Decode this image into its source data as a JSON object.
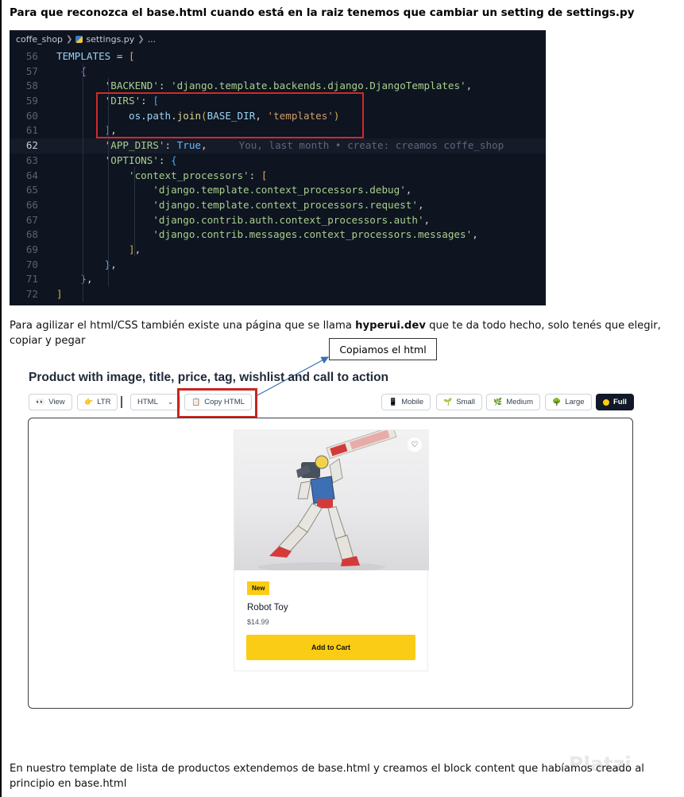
{
  "doc": {
    "heading": "Para que reconozca el base.html cuando está en la raiz tenemos que cambiar un setting de settings.py",
    "para2_before": "Para agilizar el html/CSS también existe una página que se llama ",
    "para2_bold": "hyperui.dev",
    "para2_after": " que te da todo hecho, solo tenés que elegir, copiar y pegar",
    "callout": "Copiamos el html",
    "para3": "En nuestro template de lista de productos extendemos de base.html y creamos el block content que habíamos creado al principio en base.html",
    "watermark": "Platzi"
  },
  "editor": {
    "breadcrumb": [
      "coffe_shop",
      "settings.py",
      "..."
    ],
    "lines": [
      {
        "n": "56",
        "t": "TEMPLATES = ["
      },
      {
        "n": "57",
        "t": "{"
      },
      {
        "n": "58",
        "t": "'BACKEND': 'django.template.backends.django.DjangoTemplates',"
      },
      {
        "n": "59",
        "t": "'DIRS': ["
      },
      {
        "n": "60",
        "t": "os.path.join(BASE_DIR, 'templates')"
      },
      {
        "n": "61",
        "t": "],"
      },
      {
        "n": "62",
        "t": "'APP_DIRS': True,",
        "blame": "You, last month • create: creamos coffe_shop"
      },
      {
        "n": "63",
        "t": "'OPTIONS': {"
      },
      {
        "n": "64",
        "t": "'context_processors': ["
      },
      {
        "n": "65",
        "t": "'django.template.context_processors.debug',"
      },
      {
        "n": "66",
        "t": "'django.template.context_processors.request',"
      },
      {
        "n": "67",
        "t": "'django.contrib.auth.context_processors.auth',"
      },
      {
        "n": "68",
        "t": "'django.contrib.messages.context_processors.messages',"
      },
      {
        "n": "69",
        "t": "],"
      },
      {
        "n": "70",
        "t": "},"
      },
      {
        "n": "71",
        "t": "},"
      },
      {
        "n": "72",
        "t": "]"
      }
    ]
  },
  "hyperui": {
    "title": "Product with image, title, price, tag, wishlist and call to action",
    "toolbar_left": {
      "view": "View",
      "ltr": "LTR",
      "html": "HTML",
      "copy": "Copy HTML"
    },
    "toolbar_right": {
      "mobile": "Mobile",
      "small": "Small",
      "medium": "Medium",
      "large": "Large",
      "full": "Full"
    },
    "card": {
      "badge": "New",
      "name": "Robot Toy",
      "price": "$14.99",
      "cta": "Add to Cart"
    }
  },
  "colors": {
    "highlight": "#d12a2a",
    "accent": "#facc15",
    "editor_bg": "#0e1420"
  }
}
